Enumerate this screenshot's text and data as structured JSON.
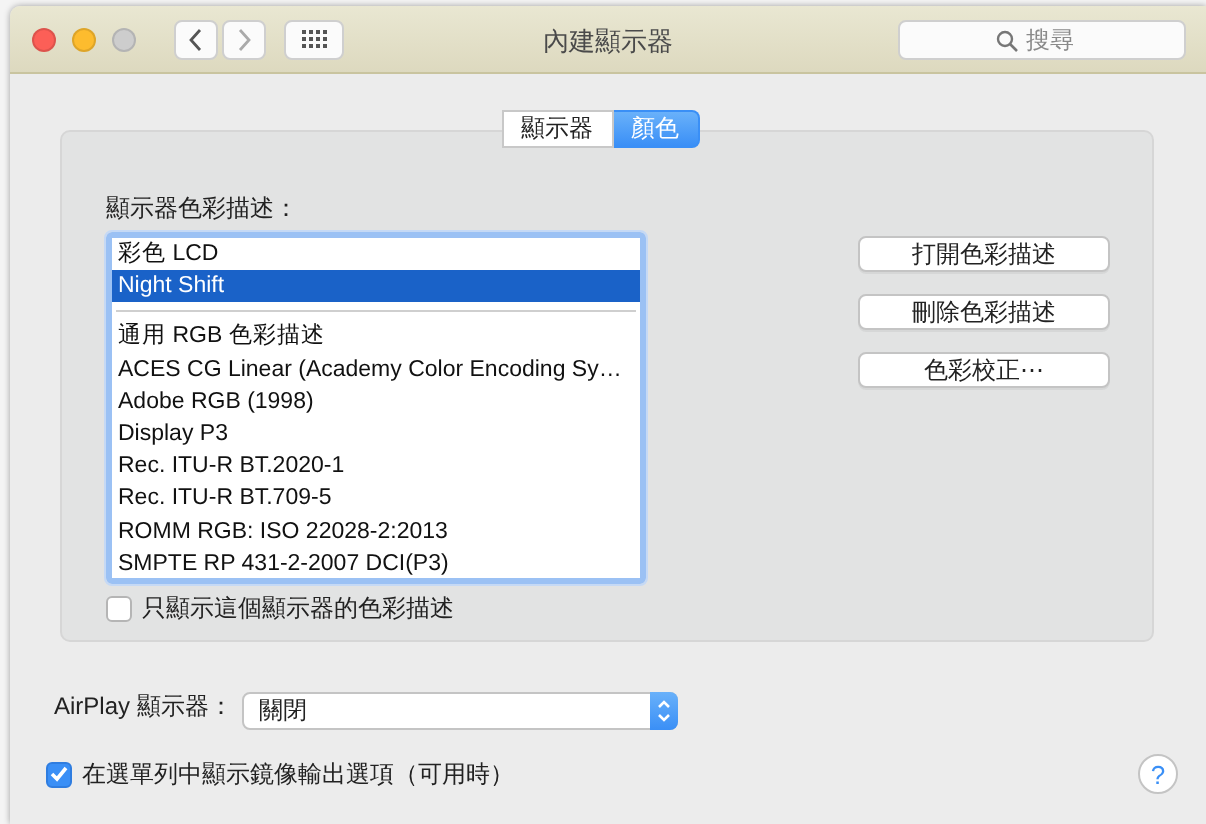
{
  "window": {
    "title": "內建顯示器",
    "search": {
      "placeholder": "搜尋"
    }
  },
  "tabs": [
    {
      "label": "顯示器",
      "selected": false
    },
    {
      "label": "顏色",
      "selected": true
    }
  ],
  "profiles": {
    "label": "顯示器色彩描述：",
    "items": [
      {
        "kind": "row",
        "label": "彩色 LCD",
        "selected": false
      },
      {
        "kind": "row",
        "label": "Night Shift",
        "selected": true
      },
      {
        "kind": "separator"
      },
      {
        "kind": "row",
        "label": "通用 RGB 色彩描述",
        "selected": false
      },
      {
        "kind": "row",
        "label": "ACES CG Linear (Academy Color Encoding Sy…",
        "selected": false
      },
      {
        "kind": "row",
        "label": "Adobe RGB (1998)",
        "selected": false
      },
      {
        "kind": "row",
        "label": "Display P3",
        "selected": false
      },
      {
        "kind": "row",
        "label": "Rec. ITU-R BT.2020-1",
        "selected": false
      },
      {
        "kind": "row",
        "label": "Rec. ITU-R BT.709-5",
        "selected": false
      },
      {
        "kind": "row",
        "label": "ROMM RGB: ISO 22028-2:2013",
        "selected": false
      },
      {
        "kind": "row",
        "label": "SMPTE RP 431-2-2007 DCI(P3)",
        "selected": false
      }
    ]
  },
  "only_this_display": {
    "label": "只顯示這個顯示器的色彩描述",
    "checked": false
  },
  "buttons": [
    "打開色彩描述",
    "刪除色彩描述",
    "色彩校正⋯"
  ],
  "airplay": {
    "label": "AirPlay 顯示器：",
    "value": "關閉"
  },
  "mirroring": {
    "label": "在選單列中顯示鏡像輸出選項（可用時）",
    "checked": true
  },
  "help": "?"
}
